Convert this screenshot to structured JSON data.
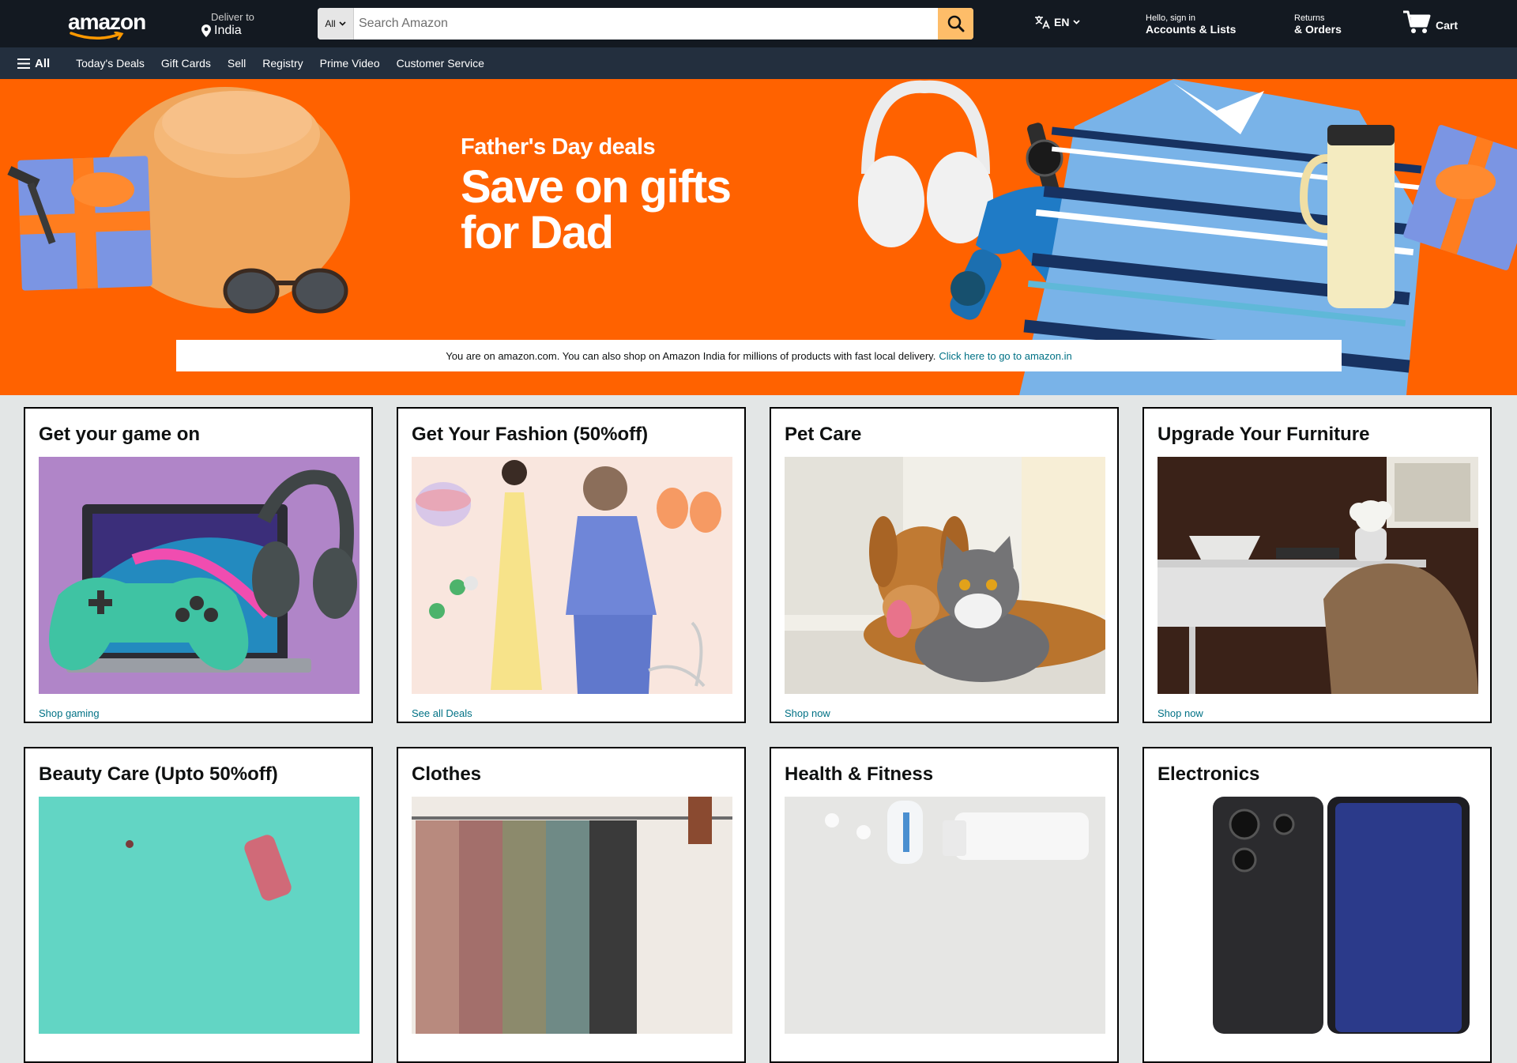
{
  "header": {
    "logo_text": "amazon",
    "deliver_label": "Deliver to",
    "deliver_location": "India",
    "search_category": "All",
    "search_placeholder": "Search Amazon",
    "language": "EN",
    "account_line1": "Hello, sign in",
    "account_line2": "Accounts & Lists",
    "returns_line1": "Returns",
    "returns_line2": "& Orders",
    "cart_label": "Cart"
  },
  "subnav": {
    "all_label": "All",
    "links": [
      "Today's Deals",
      "Gift Cards",
      "Sell",
      "Registry",
      "Prime Video",
      "Customer Service"
    ]
  },
  "hero": {
    "subtitle": "Father's Day deals",
    "title": "Save on gifts for Dad",
    "notice_text": "You are on amazon.com. You can also shop on Amazon India for millions of products with fast local delivery.",
    "notice_link": "Click here to go to amazon.in"
  },
  "cards": [
    {
      "title": "Get your game on",
      "link": "Shop gaming"
    },
    {
      "title": "Get Your Fashion (50%off)",
      "link": "See all Deals"
    },
    {
      "title": "Pet Care",
      "link": "Shop now"
    },
    {
      "title": "Upgrade Your Furniture",
      "link": "Shop now"
    },
    {
      "title": "Beauty Care (Upto 50%off)",
      "link": ""
    },
    {
      "title": "Clothes",
      "link": ""
    },
    {
      "title": "Health & Fitness",
      "link": ""
    },
    {
      "title": "Electronics",
      "link": ""
    }
  ],
  "colors": {
    "topbar": "#131921",
    "subnav": "#232f3e",
    "hero_bg": "#ff6200",
    "search_button": "#febd69",
    "link": "#007185"
  }
}
